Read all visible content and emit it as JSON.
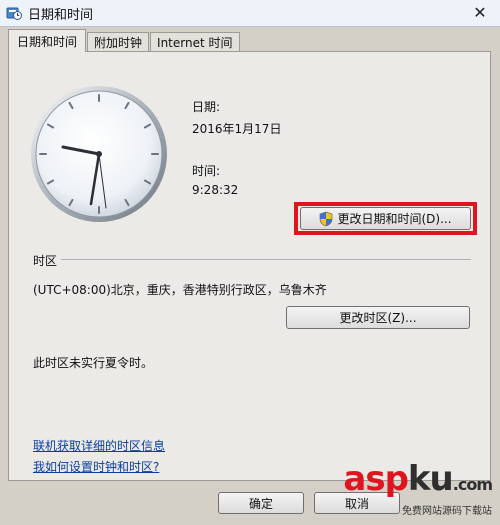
{
  "window": {
    "title": "日期和时间"
  },
  "tabs": [
    {
      "label": "日期和时间"
    },
    {
      "label": "附加时钟"
    },
    {
      "label": "Internet 时间"
    }
  ],
  "datetime": {
    "date_label": "日期:",
    "date_value": "2016年1月17日",
    "time_label": "时间:",
    "time_value": "9:28:32",
    "change_button": "更改日期和时间(D)..."
  },
  "timezone": {
    "section_label": "时区",
    "value": "(UTC+08:00)北京，重庆，香港特别行政区，乌鲁木齐",
    "change_button": "更改时区(Z)...",
    "dst_note": "此时区未实行夏令时。"
  },
  "links": {
    "online_info": "联机获取详细的时区信息",
    "how_to": "我如何设置时钟和时区?"
  },
  "footer": {
    "ok": "确定",
    "cancel": "取消"
  },
  "watermark": {
    "logo": "aspku",
    "sub": "免费网站源码下载站"
  },
  "colors": {
    "highlight": "#e0141f",
    "link": "#0a3ea0"
  },
  "icons": {
    "title": "clock-globe-icon",
    "shield": "uac-shield-icon",
    "close": "close-icon"
  }
}
